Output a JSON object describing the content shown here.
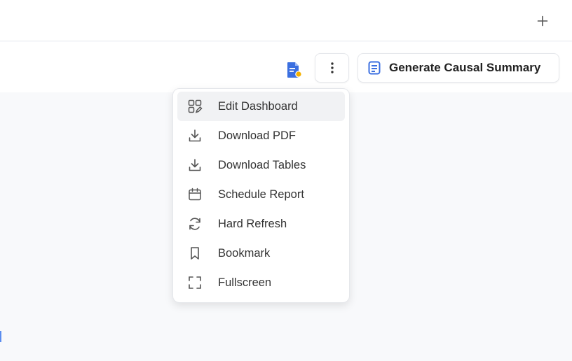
{
  "topbar": {
    "add_icon": "plus-icon"
  },
  "header": {
    "doc_icon": "document-report-icon",
    "more_icon": "vertical-dots-icon",
    "generate_button": {
      "label": "Generate Causal Summary",
      "icon": "summary-doc-icon"
    }
  },
  "menu": {
    "items": [
      {
        "label": "Edit Dashboard",
        "icon": "edit-layout-icon",
        "active": true
      },
      {
        "label": "Download PDF",
        "icon": "download-icon"
      },
      {
        "label": "Download Tables",
        "icon": "download-icon"
      },
      {
        "label": "Schedule Report",
        "icon": "calendar-icon"
      },
      {
        "label": "Hard Refresh",
        "icon": "refresh-icon"
      },
      {
        "label": "Bookmark",
        "icon": "bookmark-icon"
      },
      {
        "label": "Fullscreen",
        "icon": "fullscreen-icon"
      }
    ]
  },
  "colors": {
    "accent": "#3b6fe0",
    "badge": "#f4b000",
    "hover_bg": "#f1f2f4"
  }
}
